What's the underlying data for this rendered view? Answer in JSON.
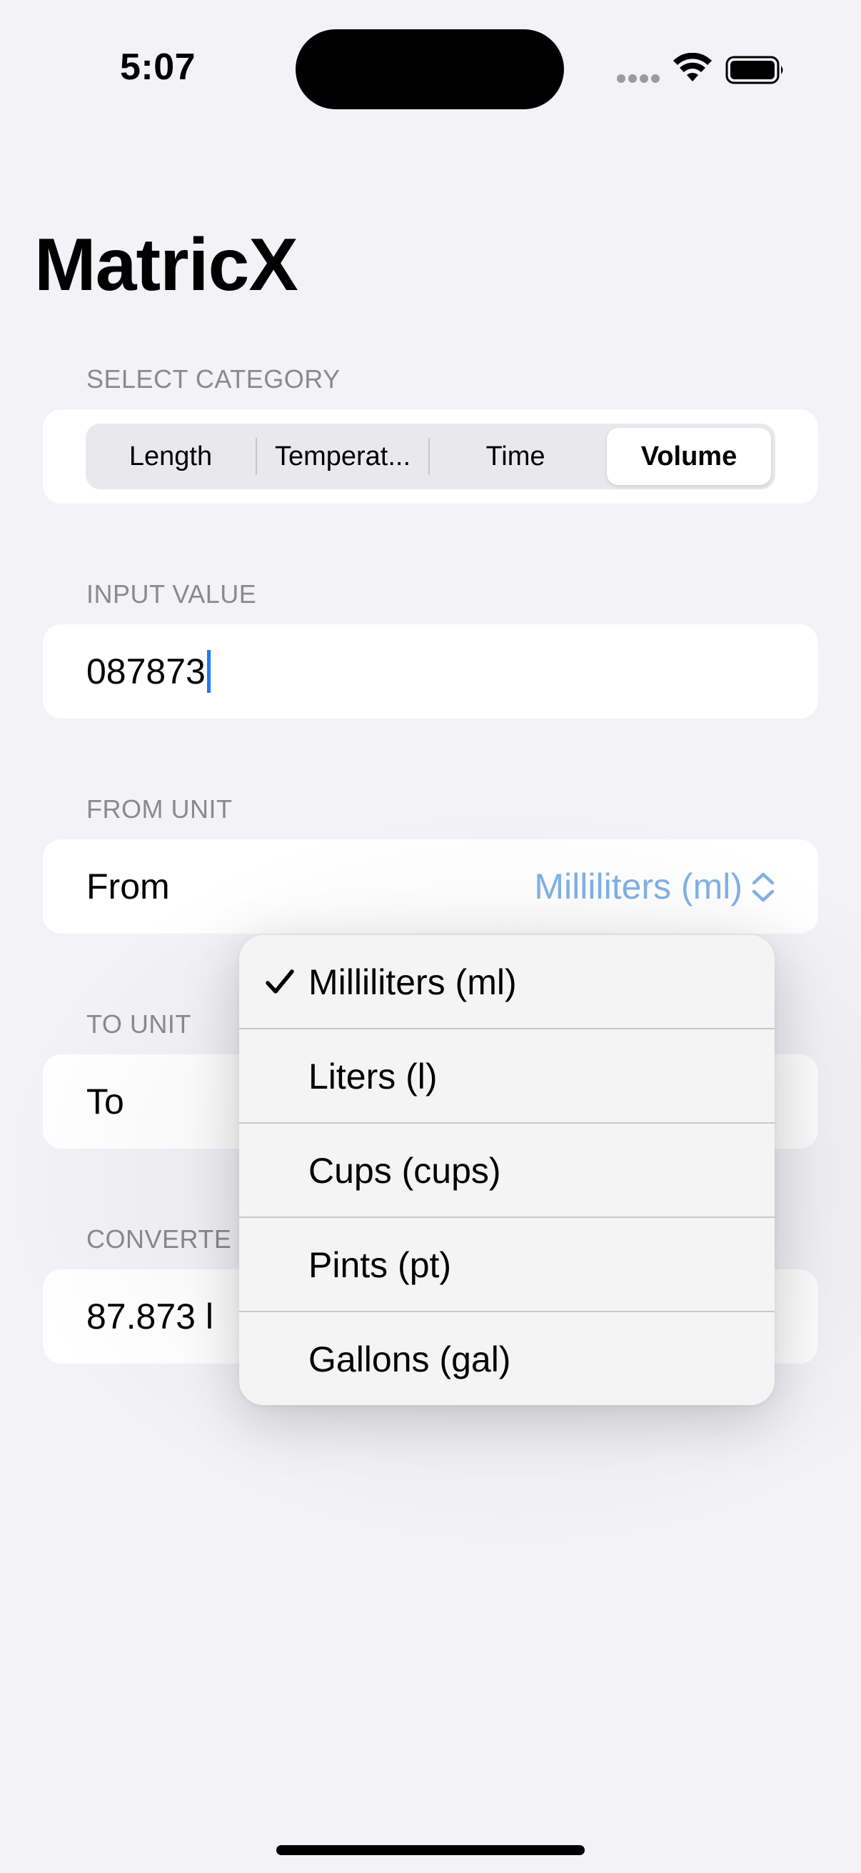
{
  "status_bar": {
    "time": "5:07"
  },
  "app": {
    "title": "MatricX"
  },
  "category": {
    "header": "SELECT CATEGORY",
    "segments": [
      "Length",
      "Temperat...",
      "Time",
      "Volume"
    ],
    "selected": "Volume"
  },
  "input": {
    "header": "INPUT VALUE",
    "value": "087873"
  },
  "from_unit": {
    "header": "FROM UNIT",
    "label": "From",
    "value": "Milliliters (ml)"
  },
  "to_unit": {
    "header": "TO UNIT",
    "label": "To"
  },
  "converted": {
    "header": "CONVERTE",
    "value": "87.873 l"
  },
  "menu": {
    "items": [
      {
        "label": "Milliliters (ml)",
        "checked": true
      },
      {
        "label": "Liters (l)",
        "checked": false
      },
      {
        "label": "Cups (cups)",
        "checked": false
      },
      {
        "label": "Pints (pt)",
        "checked": false
      },
      {
        "label": "Gallons (gal)",
        "checked": false
      }
    ]
  },
  "colors": {
    "background": "#f2f2f7",
    "accent": "#1a7cf5",
    "picker_value": "#7fb2e6",
    "secondary_text": "#8a8a8e"
  },
  "icons": [
    "wifi-icon",
    "battery-icon",
    "chevron-updown-icon",
    "checkmark-icon"
  ]
}
